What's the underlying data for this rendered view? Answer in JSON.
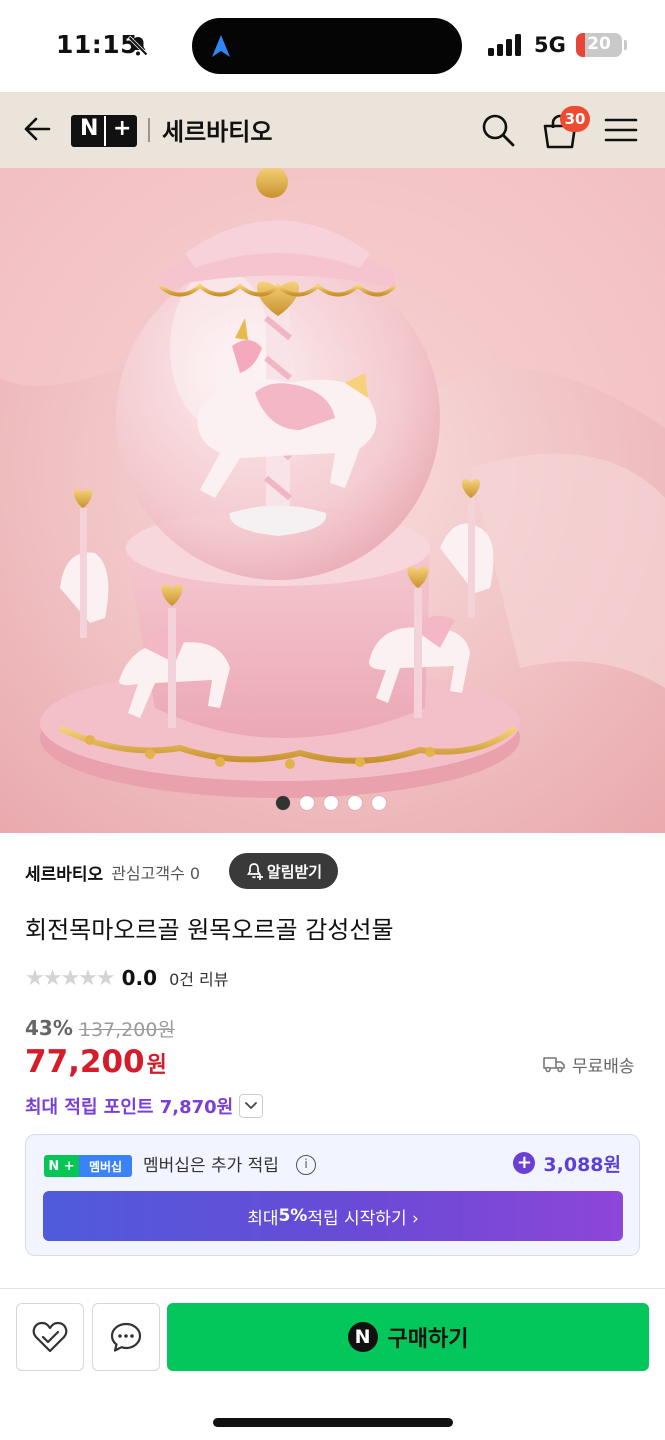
{
  "status_bar": {
    "time": "11:15",
    "network": "5G",
    "battery": "20",
    "battery_level": 0.2
  },
  "nav": {
    "logo_n": "N",
    "logo_plus": "+",
    "store_title": "세르바티오",
    "cart_count": "30"
  },
  "hero": {
    "slide_count": 5,
    "active_slide": 1
  },
  "product": {
    "store_name": "세르바티오",
    "followers": "관심고객수 0",
    "alert_button": "알림받기",
    "title": "회전목마오르골 원목오르골 감성선물",
    "rating_value": "0.0",
    "rating_stars": 0,
    "review_count": "0건 리뷰",
    "discount": "43%",
    "original_price": "137,200원",
    "price": "77,200",
    "currency": "원",
    "shipping": "무료배송",
    "max_points": "최대 적립 포인트 7,870원"
  },
  "membership": {
    "badge_left": "N +",
    "badge_right": "멤버십",
    "text": "멤버십은 추가 적립",
    "info": "i",
    "points": "3,088원",
    "button_prefix": "최대 ",
    "button_highlight": "5%",
    "button_suffix": " 적립 시작하기 ›"
  },
  "actions": {
    "buy_icon": "N",
    "buy_label": "구매하기"
  },
  "colors": {
    "price_red": "#d51c2a",
    "points_purple": "#7a3fd6",
    "buy_green": "#03c75a",
    "nav_bg": "#ebe4da"
  }
}
